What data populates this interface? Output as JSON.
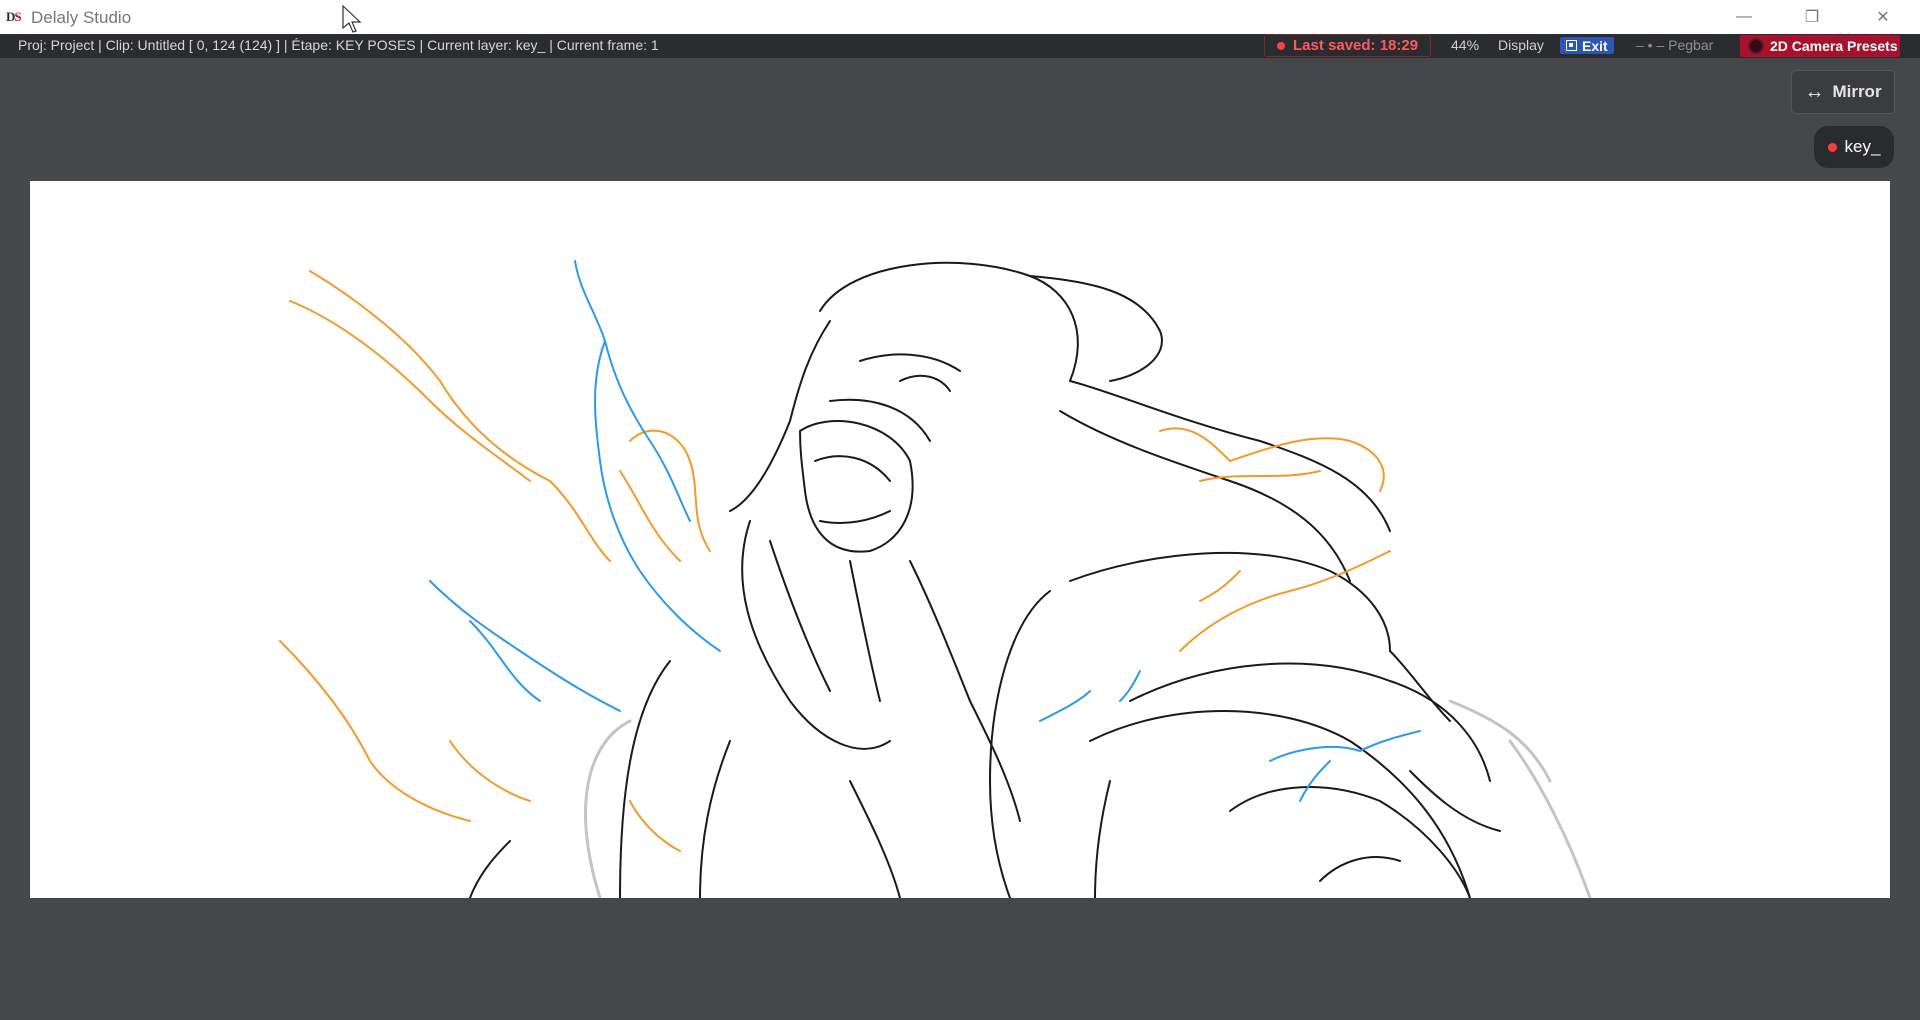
{
  "app": {
    "logo_d": "D",
    "logo_s": "S",
    "title": "Delaly Studio"
  },
  "window_controls": {
    "minimize": "—",
    "maximize": "❐",
    "close": "✕"
  },
  "status": {
    "info": "Proj: Project | Clip: Untitled [ 0, 124 (124) ] | Étape: KEY POSES | Current layer: key_ | Current frame: 1",
    "last_saved": "Last saved: 18:29",
    "zoom": "44%",
    "display": "Display",
    "exit": "Exit",
    "pegbar": "– • – Pegbar",
    "camera_presets": "2D Camera Presets"
  },
  "controls": {
    "mirror_icon": "↔",
    "mirror_label": "Mirror",
    "layer_label": "key_"
  },
  "colors": {
    "accent_camera": "#a8112e",
    "exit_blue": "#2e55b3",
    "saved_red": "#ff5a5a",
    "stroke_orange": "#f39a2a",
    "stroke_blue": "#2b9be8",
    "stroke_black": "#1a1a1a",
    "stroke_gray": "#bdbdbd"
  }
}
